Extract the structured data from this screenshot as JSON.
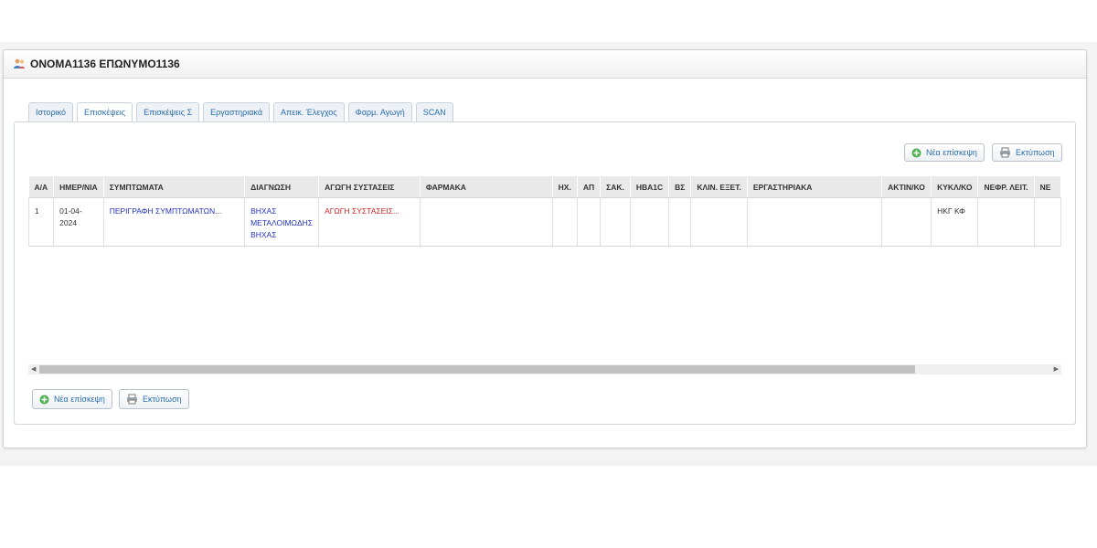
{
  "patient": {
    "name": "ΟΝΟΜΑ1136 ΕΠΩΝΥΜΟ1136",
    "icon": "users-icon"
  },
  "tabs": [
    {
      "label": "Ιστορικό",
      "active": false
    },
    {
      "label": "Επισκέψεις",
      "active": true
    },
    {
      "label": "Επισκέψεις Σ",
      "active": false
    },
    {
      "label": "Εργαστηριακά",
      "active": false
    },
    {
      "label": "Απεικ. Έλεγχος",
      "active": false
    },
    {
      "label": "Φαρμ. Αγωγή",
      "active": false
    },
    {
      "label": "SCAN",
      "active": false
    }
  ],
  "actions": {
    "new_visit_label": "Νέα επίσκεψη",
    "print_label": "Εκτύπωση"
  },
  "table": {
    "columns": [
      "Α/Α",
      "ΗΜΕΡ/ΝΙΑ",
      "ΣΥΜΠΤΩΜΑΤΑ",
      "ΔΙΑΓΝΩΣΗ",
      "ΑΓΩΓΗ ΣΥΣΤΑΣΕΙΣ",
      "ΦΑΡΜΑΚΑ",
      "ΗΧ.",
      "ΑΠ",
      "ΣΑΚ.",
      "HBA1C",
      "ΒΣ",
      "ΚΛΙΝ. ΕΞΕΤ.",
      "ΕΡΓΑΣΤΗΡΙΑΚΑ",
      "ΑΚΤΙΝ/ΚΟ",
      "ΚΥΚΛ/ΚΟ",
      "ΝΕΦΡ. ΛΕΙΤ.",
      "ΝΕ"
    ],
    "rows": [
      {
        "aa": "1",
        "date": "01-04-2024",
        "symptoms": "ΠΕΡΙΓΡΑΦΗ ΣΥΜΠΤΩΜΑΤΩΝ...",
        "diagnosis": "ΒΗΧΑΣ ΜΕΤΑΛΟΙΜΩΔΗΣ ΒΗΧΑΣ",
        "treatment": "ΑΓΩΓΗ ΣΥΣΤΑΣΕΙΣ...",
        "drugs": "",
        "hx": "",
        "ap": "",
        "sak": "",
        "hba1c": "",
        "bs": "",
        "klin": "",
        "erg": "",
        "aktin": "",
        "kykl": "ΗΚΓ ΚΦ",
        "nefr": "",
        "ne": ""
      }
    ]
  },
  "colors": {
    "link": "#2a6db0",
    "symptoms": "#2233bb",
    "treatment": "#cc2222"
  }
}
